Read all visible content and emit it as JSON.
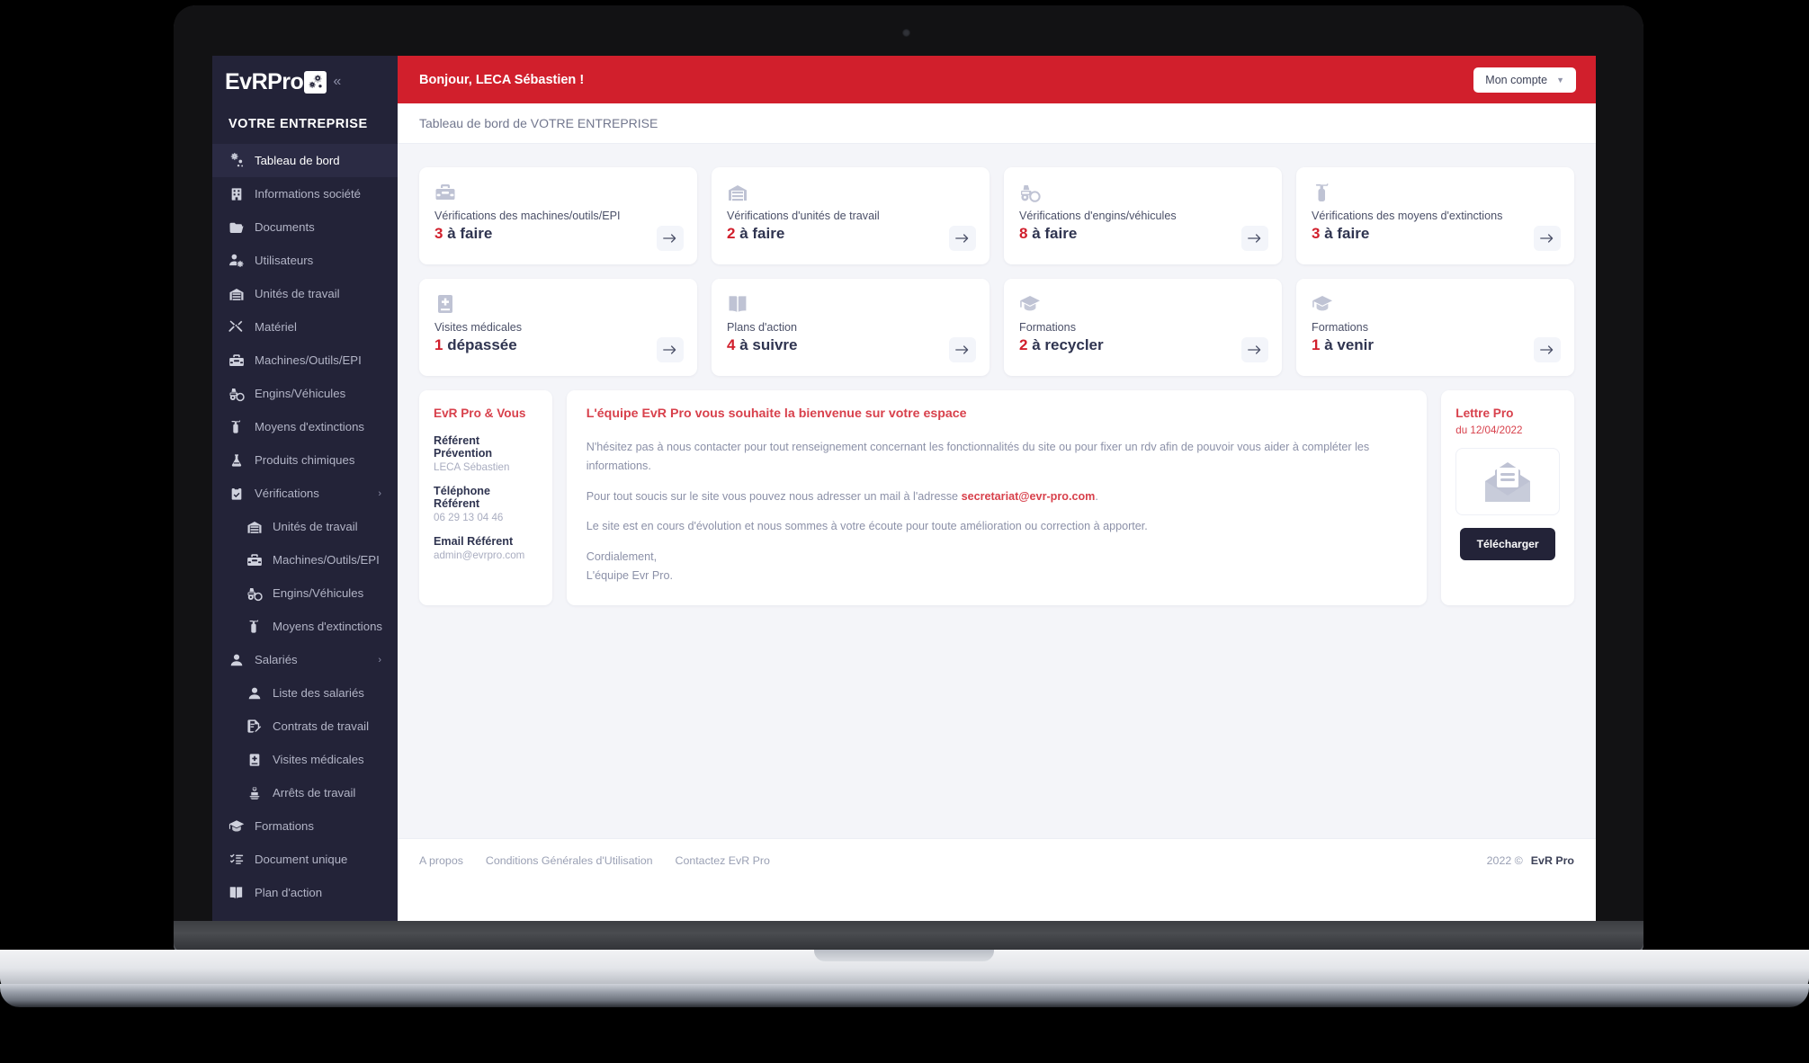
{
  "brand": {
    "name": "EvRPro",
    "logo_icon": "gears-icon",
    "collapse_icon": "chevron-double-left-icon"
  },
  "sidebar": {
    "company": "VOTRE ENTREPRISE",
    "items": [
      {
        "label": "Tableau de bord",
        "icon": "gears-icon",
        "active": true,
        "sub": false,
        "expandable": false
      },
      {
        "label": "Informations société",
        "icon": "building-icon",
        "active": false,
        "sub": false,
        "expandable": false
      },
      {
        "label": "Documents",
        "icon": "folder-icon",
        "active": false,
        "sub": false,
        "expandable": false
      },
      {
        "label": "Utilisateurs",
        "icon": "user-gear-icon",
        "active": false,
        "sub": false,
        "expandable": false
      },
      {
        "label": "Unités de travail",
        "icon": "warehouse-icon",
        "active": false,
        "sub": false,
        "expandable": false
      },
      {
        "label": "Matériel",
        "icon": "tools-icon",
        "active": false,
        "sub": false,
        "expandable": false
      },
      {
        "label": "Machines/Outils/EPI",
        "icon": "toolbox-icon",
        "active": false,
        "sub": false,
        "expandable": false
      },
      {
        "label": "Engins/Véhicules",
        "icon": "tractor-icon",
        "active": false,
        "sub": false,
        "expandable": false
      },
      {
        "label": "Moyens d'extinctions",
        "icon": "fire-extinguisher-icon",
        "active": false,
        "sub": false,
        "expandable": false
      },
      {
        "label": "Produits chimiques",
        "icon": "flask-icon",
        "active": false,
        "sub": false,
        "expandable": false
      },
      {
        "label": "Vérifications",
        "icon": "clipboard-check-icon",
        "active": false,
        "sub": false,
        "expandable": true
      },
      {
        "label": "Unités de travail",
        "icon": "warehouse-icon",
        "active": false,
        "sub": true,
        "expandable": false
      },
      {
        "label": "Machines/Outils/EPI",
        "icon": "toolbox-icon",
        "active": false,
        "sub": true,
        "expandable": false
      },
      {
        "label": "Engins/Véhicules",
        "icon": "tractor-icon",
        "active": false,
        "sub": true,
        "expandable": false
      },
      {
        "label": "Moyens d'extinctions",
        "icon": "fire-extinguisher-icon",
        "active": false,
        "sub": true,
        "expandable": false
      },
      {
        "label": "Salariés",
        "icon": "user-icon",
        "active": false,
        "sub": false,
        "expandable": true
      },
      {
        "label": "Liste des salariés",
        "icon": "user-icon",
        "active": false,
        "sub": true,
        "expandable": false
      },
      {
        "label": "Contrats de travail",
        "icon": "contract-icon",
        "active": false,
        "sub": true,
        "expandable": false
      },
      {
        "label": "Visites médicales",
        "icon": "medical-book-icon",
        "active": false,
        "sub": true,
        "expandable": false
      },
      {
        "label": "Arrêts de travail",
        "icon": "injured-person-icon",
        "active": false,
        "sub": true,
        "expandable": false
      },
      {
        "label": "Formations",
        "icon": "graduation-cap-icon",
        "active": false,
        "sub": false,
        "expandable": false
      },
      {
        "label": "Document unique",
        "icon": "list-check-icon",
        "active": false,
        "sub": false,
        "expandable": false
      },
      {
        "label": "Plan d'action",
        "icon": "book-icon",
        "active": false,
        "sub": false,
        "expandable": false
      }
    ]
  },
  "topbar": {
    "greeting": "Bonjour, LECA Sébastien !",
    "account_label": "Mon compte",
    "account_caret_icon": "chevron-down-icon"
  },
  "breadcrumb": "Tableau de bord de VOTRE ENTREPRISE",
  "cards": [
    {
      "icon": "toolbox-icon",
      "label": "Vérifications des machines/outils/EPI",
      "count": "3",
      "suffix": "à faire",
      "arrow_icon": "arrow-right-icon"
    },
    {
      "icon": "warehouse-icon",
      "label": "Vérifications d'unités de travail",
      "count": "2",
      "suffix": "à faire",
      "arrow_icon": "arrow-right-icon"
    },
    {
      "icon": "tractor-icon",
      "label": "Vérifications d'engins/véhicules",
      "count": "8",
      "suffix": "à faire",
      "arrow_icon": "arrow-right-icon"
    },
    {
      "icon": "fire-extinguisher-icon",
      "label": "Vérifications des moyens d'extinctions",
      "count": "3",
      "suffix": "à faire",
      "arrow_icon": "arrow-right-icon"
    },
    {
      "icon": "medical-book-icon",
      "label": "Visites médicales",
      "count": "1",
      "suffix": "dépassée",
      "arrow_icon": "arrow-right-icon"
    },
    {
      "icon": "book-icon",
      "label": "Plans d'action",
      "count": "4",
      "suffix": "à suivre",
      "arrow_icon": "arrow-right-icon"
    },
    {
      "icon": "graduation-cap-icon",
      "label": "Formations",
      "count": "2",
      "suffix": "à recycler",
      "arrow_icon": "arrow-right-icon"
    },
    {
      "icon": "graduation-cap-icon",
      "label": "Formations",
      "count": "1",
      "suffix": "à venir",
      "arrow_icon": "arrow-right-icon"
    }
  ],
  "contact_panel": {
    "title": "EvR Pro & Vous",
    "rows": [
      {
        "label": "Référent Prévention",
        "value": "LECA Sébastien"
      },
      {
        "label": "Téléphone Référent",
        "value": "06 29 13 04 46"
      },
      {
        "label": "Email Référent",
        "value": "admin@evrpro.com"
      }
    ]
  },
  "welcome_panel": {
    "heading": "L'équipe EvR Pro vous souhaite la bienvenue sur votre espace",
    "p1": "N'hésitez pas à nous contacter pour tout renseignement concernant les fonctionnalités du site ou pour fixer un rdv afin de pouvoir vous aider à compléter les informations.",
    "p2_before": "Pour tout soucis sur le site vous pouvez nous adresser un mail à l'adresse ",
    "p2_link": "secretariat@evr-pro.com",
    "p2_after": ".",
    "p3": "Le site est en cours d'évolution et nous sommes à votre écoute pour toute amélioration ou correction à apporter.",
    "p4_line1": "Cordialement,",
    "p4_line2": "L'équipe Evr Pro."
  },
  "lettre_panel": {
    "title": "Lettre Pro",
    "date": "du 12/04/2022",
    "thumb_icon": "open-envelope-letter-icon",
    "download_label": "Télécharger"
  },
  "footer": {
    "links": [
      "A propos",
      "Conditions Générales d'Utilisation",
      "Contactez EvR Pro"
    ],
    "year": "2022 ©",
    "brand": "EvR Pro"
  },
  "colors": {
    "brand_red": "#d11f2c",
    "sidebar_dark": "#232338",
    "page_bg": "#f4f5f9",
    "accent_red_soft": "#d8414c"
  }
}
